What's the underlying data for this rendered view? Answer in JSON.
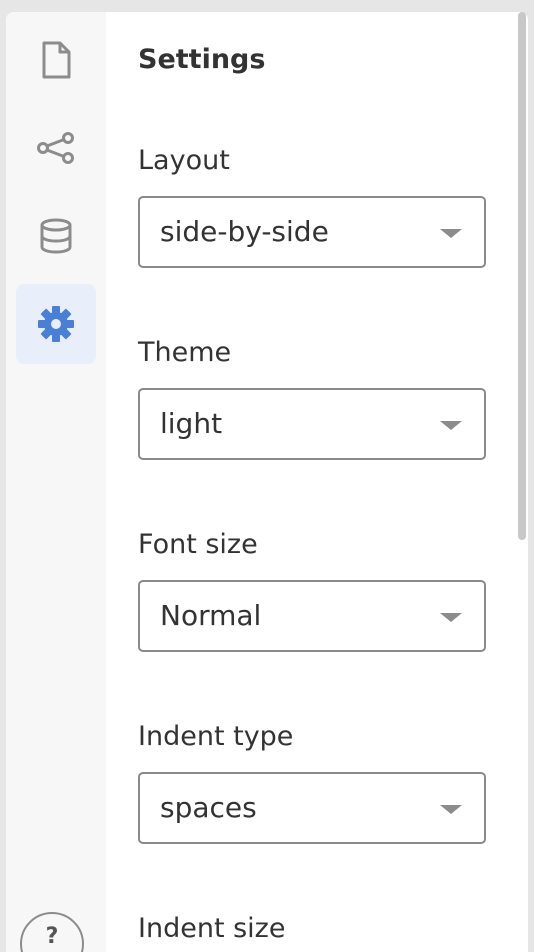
{
  "sidebar": {
    "items": [
      {
        "name": "file-icon",
        "active": false
      },
      {
        "name": "share-icon",
        "active": false
      },
      {
        "name": "database-icon",
        "active": false
      },
      {
        "name": "gear-icon",
        "active": true
      }
    ],
    "help_label": "?"
  },
  "settings": {
    "title": "Settings",
    "fields": [
      {
        "label": "Layout",
        "value": "side-by-side"
      },
      {
        "label": "Theme",
        "value": "light"
      },
      {
        "label": "Font size",
        "value": "Normal"
      },
      {
        "label": "Indent type",
        "value": "spaces"
      },
      {
        "label": "Indent size",
        "value": ""
      }
    ]
  },
  "colors": {
    "accent": "#4a7fd8",
    "active_bg": "#e8effb",
    "icon_gray": "#8c8c8c"
  }
}
